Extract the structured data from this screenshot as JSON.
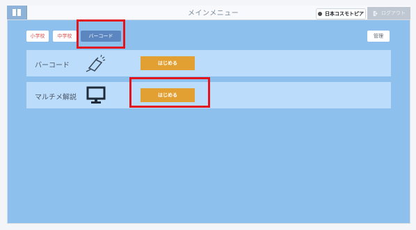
{
  "header": {
    "title": "メインメニュー",
    "brand": "日本コスモトピア",
    "logout": "ログアウト"
  },
  "tabs": [
    {
      "label": "小学校"
    },
    {
      "label": "中学校"
    },
    {
      "label": "バーコード"
    }
  ],
  "manage_label": "管理",
  "rows": [
    {
      "label": "バーコード",
      "icon": "barcode-scanner-icon",
      "button": "はじめる"
    },
    {
      "label": "マルチメ解説",
      "icon": "monitor-icon",
      "button": "はじめる"
    }
  ],
  "colors": {
    "panel": "#8ec0ee",
    "row": "#bcdcfb",
    "active_tab": "#5c86bf",
    "start_button": "#e2a032",
    "highlight": "#e2151c"
  }
}
